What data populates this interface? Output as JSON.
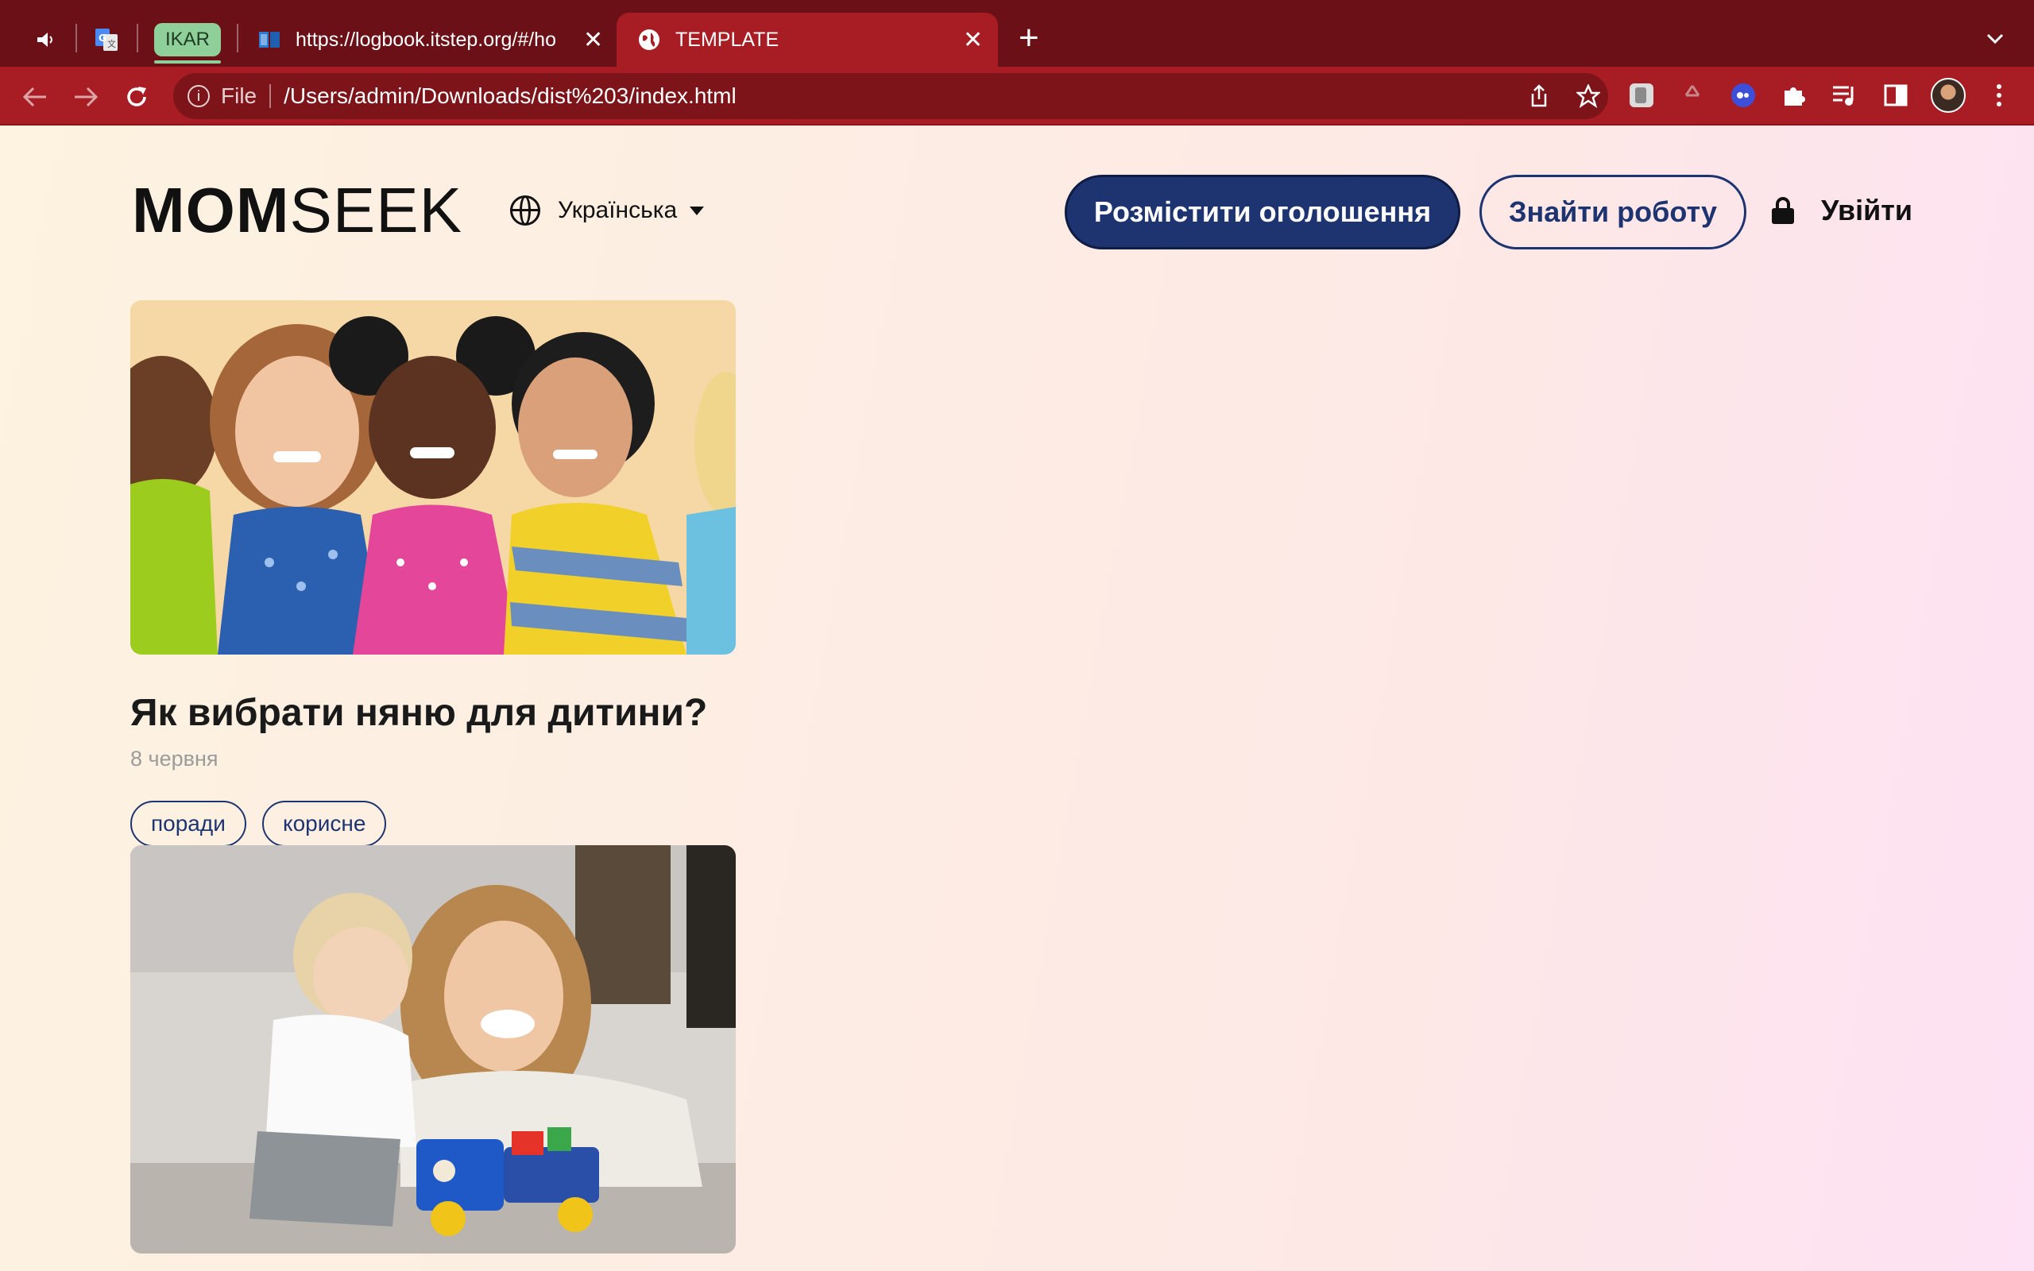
{
  "browser": {
    "tabs": [
      {
        "type": "pinned",
        "icon": "speaker-icon"
      },
      {
        "type": "pinned",
        "icon": "google-translate-icon"
      },
      {
        "type": "group",
        "label": "IKAR",
        "color": "#8fd09a"
      },
      {
        "type": "tab",
        "icon": "book-icon",
        "title": "https://logbook.itstep.org/#/ho"
      },
      {
        "type": "tab",
        "icon": "globe-icon",
        "title": "TEMPLATE",
        "active": true
      }
    ],
    "address": {
      "scheme_label": "File",
      "url": "/Users/admin/Downloads/dist%203/index.html"
    },
    "theme_colors": {
      "tabstrip": "#6b1016",
      "toolbar": "#a81d24"
    }
  },
  "site": {
    "logo": {
      "bold": "MOM",
      "light": "SEEK"
    },
    "language": "Українська",
    "post_button": "Розмістити оголошення",
    "find_job_button": "Знайти роботу",
    "login": "Увійти",
    "brand_color": "#1e3470"
  },
  "articles": [
    {
      "title": "Як вибрати няню для дитини?",
      "date": "8 червня",
      "tags": [
        "поради",
        "корисне"
      ]
    }
  ]
}
